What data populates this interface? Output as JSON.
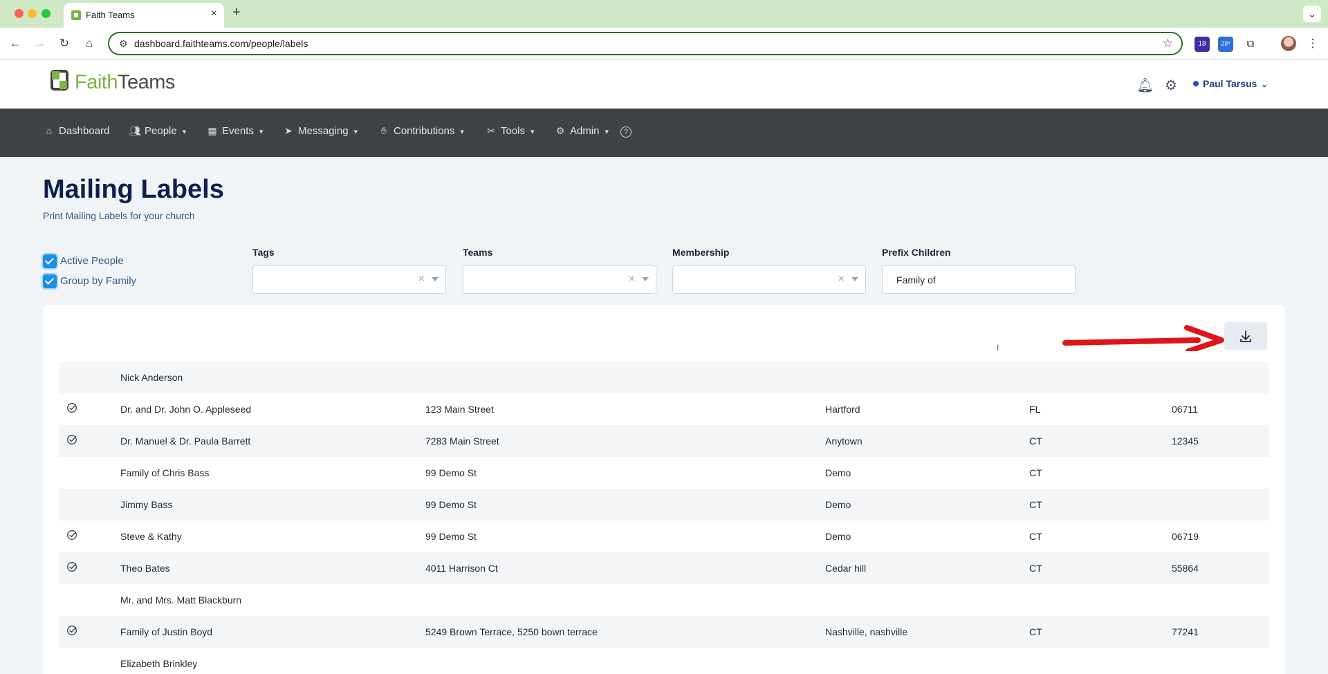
{
  "browser": {
    "tab_title": "Faith Teams",
    "url": "dashboard.faithteams.com/people/labels",
    "extension_badge": "18",
    "zip_label": "ZIP"
  },
  "app": {
    "brand_part1": "Faith",
    "brand_part2": "Teams",
    "user_name": "Paul Tarsus"
  },
  "nav": [
    {
      "label": "Dashboard",
      "icon": "home-icon"
    },
    {
      "label": "People",
      "icon": "people-icon"
    },
    {
      "label": "Events",
      "icon": "calendar-icon"
    },
    {
      "label": "Messaging",
      "icon": "paper-plane-icon"
    },
    {
      "label": "Contributions",
      "icon": "hand-coin-icon"
    },
    {
      "label": "Tools",
      "icon": "tools-icon"
    },
    {
      "label": "Admin",
      "icon": "gear-icon"
    }
  ],
  "page": {
    "title": "Mailing Labels",
    "subtitle": "Print Mailing Labels for your church"
  },
  "filters": {
    "active_people": "Active People",
    "group_by_family": "Group by Family",
    "tags_label": "Tags",
    "teams_label": "Teams",
    "membership_label": "Membership",
    "prefix_label": "Prefix Children",
    "prefix_value": "Family of"
  },
  "rows": [
    {
      "checked": false,
      "name": "Nick Anderson",
      "address": "",
      "city": "",
      "state": "",
      "zip": ""
    },
    {
      "checked": true,
      "name": "Dr. and Dr. John O. Appleseed",
      "address": "123 Main Street",
      "city": "Hartford",
      "state": "FL",
      "zip": "06711"
    },
    {
      "checked": true,
      "name": "Dr. Manuel & Dr. Paula Barrett",
      "address": "7283 Main Street",
      "city": "Anytown",
      "state": "CT",
      "zip": "12345"
    },
    {
      "checked": false,
      "name": "Family of Chris Bass",
      "address": "99 Demo St",
      "city": "Demo",
      "state": "CT",
      "zip": ""
    },
    {
      "checked": false,
      "name": "Jimmy Bass",
      "address": "99 Demo St",
      "city": "Demo",
      "state": "CT",
      "zip": ""
    },
    {
      "checked": true,
      "name": "Steve & Kathy",
      "address": "99 Demo St",
      "city": "Demo",
      "state": "CT",
      "zip": "06719"
    },
    {
      "checked": true,
      "name": "Theo Bates",
      "address": "4011 Harrison Ct",
      "city": "Cedar hill",
      "state": "CT",
      "zip": "55864"
    },
    {
      "checked": false,
      "name": "Mr. and Mrs. Matt Blackburn",
      "address": "",
      "city": "",
      "state": "",
      "zip": ""
    },
    {
      "checked": true,
      "name": "Family of Justin Boyd",
      "address": "5249 Brown Terrace, 5250 bown terrace",
      "city": "Nashville, nashville",
      "state": "CT",
      "zip": "77241"
    },
    {
      "checked": false,
      "name": "Elizabeth Brinkley",
      "address": "",
      "city": "",
      "state": "",
      "zip": ""
    }
  ]
}
